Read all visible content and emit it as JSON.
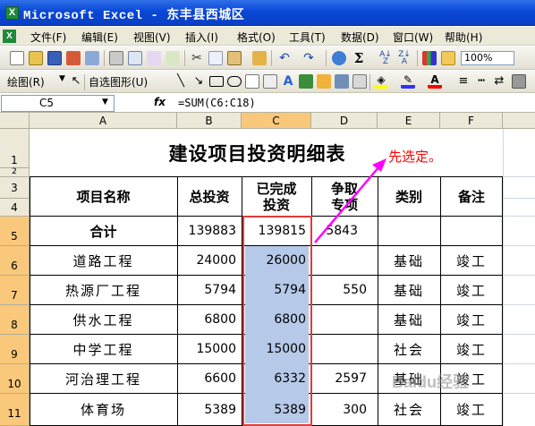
{
  "window": {
    "title": "Microsoft Excel - 东丰县西城区",
    "app_icon_letter": "X"
  },
  "menu": [
    "文件(F)",
    "编辑(E)",
    "视图(V)",
    "插入(I)",
    "格式(O)",
    "工具(T)",
    "数据(D)",
    "窗口(W)",
    "帮助(H)"
  ],
  "doc_icon_letter": "X",
  "toolbar": {
    "zoom": "100%",
    "drawing_label": "绘图(R)",
    "autoshape_label": "自选图形(U)"
  },
  "formula_bar": {
    "name_box": "C5",
    "fx": "fx",
    "formula": "=SUM(C6:C18)"
  },
  "columns": [
    "A",
    "B",
    "C",
    "D",
    "E",
    "F"
  ],
  "rows": [
    "1",
    "2",
    "3",
    "4",
    "5",
    "6",
    "7",
    "8",
    "9",
    "10",
    "11"
  ],
  "sheet": {
    "title": "建设项目投资明细表",
    "headers": {
      "name": "项目名称",
      "total": "总投资",
      "done_line1": "已完成",
      "done_line2": "投资",
      "strive_line1": "争取",
      "strive_line2": "专项",
      "category": "类别",
      "note": "备注"
    },
    "total_row": {
      "name": "合计",
      "total": "139883",
      "done": "139815",
      "strive": "5843",
      "category": "",
      "note": ""
    },
    "data_rows": [
      {
        "name": "道路工程",
        "total": "24000",
        "done": "26000",
        "strive": "",
        "category": "基础",
        "note": "竣工"
      },
      {
        "name": "热源厂工程",
        "total": "5794",
        "done": "5794",
        "strive": "550",
        "category": "基础",
        "note": "竣工"
      },
      {
        "name": "供水工程",
        "total": "6800",
        "done": "6800",
        "strive": "",
        "category": "基础",
        "note": "竣工"
      },
      {
        "name": "中学工程",
        "total": "15000",
        "done": "15000",
        "strive": "",
        "category": "社会",
        "note": "竣工"
      },
      {
        "name": "河治理工程",
        "total": "6600",
        "done": "6332",
        "strive": "2597",
        "category": "基础",
        "note": "竣工"
      },
      {
        "name": "体育场",
        "total": "5389",
        "done": "5389",
        "strive": "300",
        "category": "社会",
        "note": "竣工"
      }
    ]
  },
  "annotation": {
    "text": "先选定。",
    "color": "#ff0000",
    "arrow_color": "#ff00ff"
  },
  "watermark": "Baidu经验"
}
